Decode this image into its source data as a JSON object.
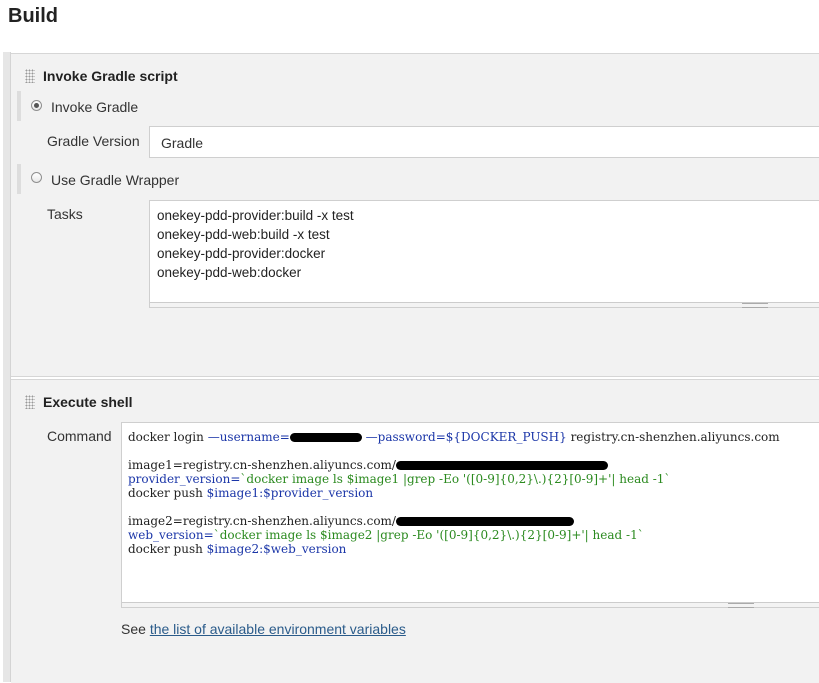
{
  "page": {
    "title": "Build"
  },
  "gradle": {
    "title": "Invoke Gradle script",
    "invoke_label": "Invoke Gradle",
    "version_label": "Gradle Version",
    "version_value": "Gradle",
    "wrapper_label": "Use Gradle Wrapper",
    "tasks_label": "Tasks",
    "tasks_value": "onekey-pdd-provider:build -x test\nonekey-pdd-web:build -x test\nonekey-pdd-provider:docker\nonekey-pdd-web:docker"
  },
  "shell": {
    "title": "Execute shell",
    "command_label": "Command",
    "lines": {
      "l1_prefix": "docker login ",
      "l1_user_opt": "—username=",
      "l1_pass_opt": " —password=${DOCKER_PUSH} ",
      "l1_host": "registry.cn-shenzhen.aliyuncs.com",
      "l2": "image1=registry.cn-shenzhen.aliyuncs.com/",
      "l3_var": "provider_version=",
      "l3_cmd": "`docker image ls $image1 |grep -Eo '([0-9]{0,2}\\.){2}[0-9]+'| head -1`",
      "l4_prefix": "docker push ",
      "l4_var": "$image1:$provider_version",
      "l5": "image2=registry.cn-shenzhen.aliyuncs.com/",
      "l6_var": "web_version=",
      "l6_cmd": "`docker image ls $image2 |grep -Eo '([0-9]{0,2}\\.){2}[0-9]+'| head -1`",
      "l7_prefix": "docker push ",
      "l7_var": "$image2:$web_version"
    }
  },
  "footer": {
    "see_text": "See ",
    "link_text": "the list of available environment variables"
  }
}
